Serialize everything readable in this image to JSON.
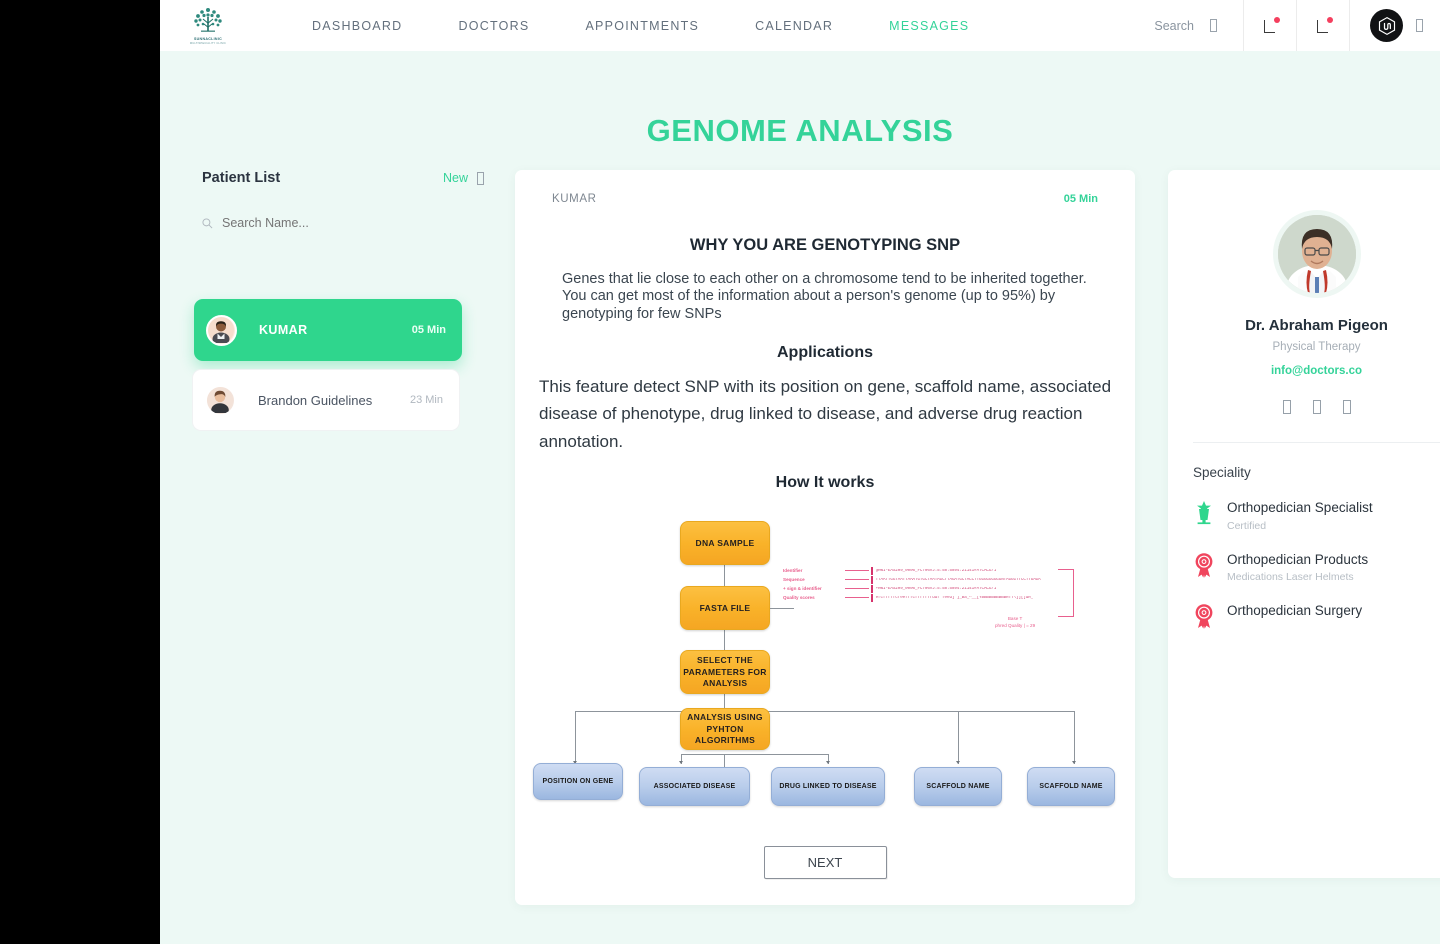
{
  "brand": {
    "logo_name": "tree-logo",
    "logo_text": "SUNNACLINIC",
    "logo_subtext": "MULTISPECIALITY CLINIC"
  },
  "colors": {
    "accent_green": "#34d399",
    "card_green": "#2fd68d",
    "page_bg": "#edf9f5",
    "flow_orange": "#f9b229",
    "flow_blue": "#b9cdeb",
    "badge_red": "#f43f5e",
    "anno_pink": "#e8608e"
  },
  "navbar": {
    "links": [
      {
        "label": "DASHBOARD",
        "active": false
      },
      {
        "label": "DOCTORS",
        "active": false
      },
      {
        "label": "APPOINTMENTS",
        "active": false
      },
      {
        "label": "CALENDAR",
        "active": false
      },
      {
        "label": "MESSAGES",
        "active": true
      }
    ],
    "search_label": "Search",
    "search_icon": "search-icon",
    "notification_icon": "bell-icon",
    "messages_icon": "bell-icon",
    "avatar_icon": "user-avatar",
    "dropdown_icon": "chevron-down-icon"
  },
  "page": {
    "title": "GENOME ANALYSIS"
  },
  "patient_list": {
    "title": "Patient List",
    "new_label": "New",
    "new_icon": "plus-icon",
    "search_placeholder": "Search Name...",
    "search_value": "",
    "search_icon": "search-icon",
    "patients": [
      {
        "name": "KUMAR",
        "time": "05 Min",
        "active": true
      },
      {
        "name": "Brandon Guidelines",
        "time": "23 Min",
        "active": false
      }
    ]
  },
  "message_card": {
    "from": "KUMAR",
    "time": "05 Min",
    "heading": "WHY YOU ARE GENOTYPING SNP",
    "paragraph": "Genes that lie close to each other on a chromosome tend to be inherited together. You can get most of the information about a person's genome (up to 95%) by genotyping for few SNPs",
    "applications_heading": "Applications",
    "applications_text": "This feature detect SNP with its position on gene, scaffold name, associated disease of phenotype, drug linked to disease, and adverse drug reaction annotation.",
    "how_heading": "How It works",
    "next_button": "NEXT"
  },
  "flowchart": {
    "nodes": {
      "dna_sample": "DNA SAMPLE",
      "fasta_file": "FASTA FILE",
      "select_parameters": "SELECT THE PARAMETERS FOR ANALYSIS",
      "analysis": "ANALYSIS USING PYHTON ALGORITHMS",
      "out1": "POSITION ON GENE",
      "out2": "ASSOCIATED DISEASE",
      "out3": "DRUG LINKED TO DISEASE",
      "out4": "SCAFFOLD NAME",
      "out5": "SCAFFOLD NAME"
    },
    "annotations": {
      "rows": [
        {
          "label": "Identifier",
          "seq": "@HWI-EAS209_0006_FC706VJ:5:58:5894:21141#ATCACG/1"
        },
        {
          "label": "Sequence",
          "seq": "TTAATTGGTAATTAAATGTGCTAATAGCTTAGATGCTACCTTGGGGGGGGGNTAGGGTTCCTTGAGA"
        },
        {
          "label": "+ sign & identifier",
          "seq": "+HWI-EAS209_0006_FC706VJ:5:58:5894:21141#ATCACG/1"
        },
        {
          "label": "Quality scores",
          "seq": "efcfffffcfeefffcfffffffddf`feed]`]_Ba_^__[YBBBBBBBBBBRTT\\]][]dR_"
        }
      ],
      "note_line1": "Base T",
      "note_line2": "phred Quality  | = 29"
    }
  },
  "doctor_card": {
    "avatar_icon": "doctor-photo",
    "name": "Dr. Abraham Pigeon",
    "role": "Physical Therapy",
    "email": "info@doctors.co",
    "socials": [
      "facebook-icon",
      "twitter-icon",
      "linkedin-icon"
    ],
    "speciality_title": "Speciality",
    "specialities": [
      {
        "label": "Orthopedician Specialist",
        "sub": "Certified",
        "icon": "trophy-icon"
      },
      {
        "label": "Orthopedician Products",
        "sub": "Medications Laser Helmets",
        "icon": "rosette-icon"
      },
      {
        "label": "Orthopedician Surgery",
        "sub": "",
        "icon": "rosette-icon"
      }
    ]
  }
}
